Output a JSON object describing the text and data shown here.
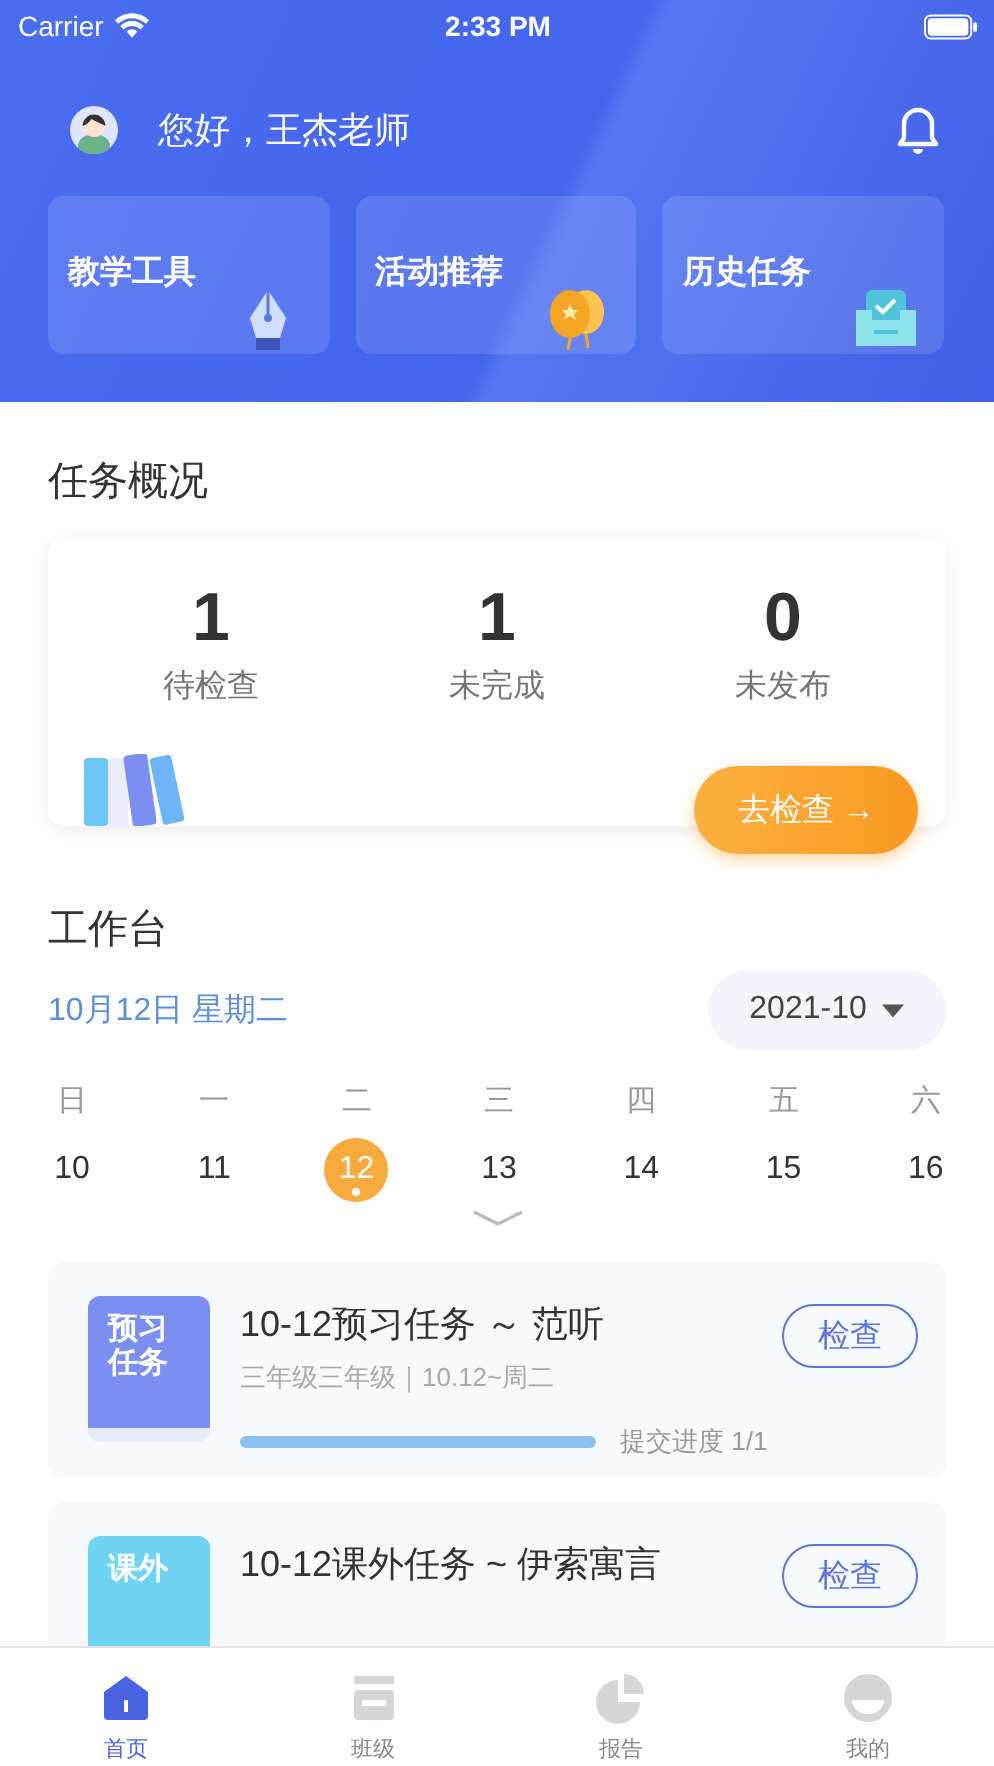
{
  "status_bar": {
    "carrier": "Carrier",
    "time": "2:33 PM"
  },
  "header": {
    "greeting": "您好，王杰老师"
  },
  "shortcuts": [
    {
      "label": "教学工具",
      "kind": "pen"
    },
    {
      "label": "活动推荐",
      "kind": "balloon"
    },
    {
      "label": "历史任务",
      "kind": "tray"
    }
  ],
  "overview": {
    "title": "任务概况",
    "stats": [
      {
        "value": "1",
        "label": "待检查"
      },
      {
        "value": "1",
        "label": "未完成"
      },
      {
        "value": "0",
        "label": "未发布"
      }
    ],
    "button": "去检查 →"
  },
  "workbench": {
    "title": "工作台",
    "date": "10月12日 星期二",
    "month": "2021-10",
    "days": [
      {
        "weekday": "日",
        "date": "10",
        "selected": false,
        "dot": false
      },
      {
        "weekday": "一",
        "date": "11",
        "selected": false,
        "dot": false
      },
      {
        "weekday": "二",
        "date": "12",
        "selected": true,
        "dot": true
      },
      {
        "weekday": "三",
        "date": "13",
        "selected": false,
        "dot": false
      },
      {
        "weekday": "四",
        "date": "14",
        "selected": false,
        "dot": false
      },
      {
        "weekday": "五",
        "date": "15",
        "selected": false,
        "dot": false
      },
      {
        "weekday": "六",
        "date": "16",
        "selected": false,
        "dot": false
      }
    ]
  },
  "tasks": [
    {
      "cover": "预习任务",
      "color": "#7b8ff0",
      "title": "10-12预习任务 ～ 范听",
      "meta": "三年级三年级｜10.12~周二",
      "level": 1,
      "progress": "提交进度 1/1",
      "button": "检查"
    },
    {
      "cover": "课外",
      "color": "#6fd3f2",
      "title": "10-12课外任务 ~ 伊索寓言",
      "button": "检查"
    }
  ],
  "tab_bar": [
    {
      "label": "首页",
      "kind": "home",
      "selected": true
    },
    {
      "label": "班级",
      "kind": "class",
      "selected": false
    },
    {
      "label": "报告",
      "kind": "report",
      "selected": false
    },
    {
      "label": "我的",
      "kind": "me",
      "selected": false
    }
  ]
}
